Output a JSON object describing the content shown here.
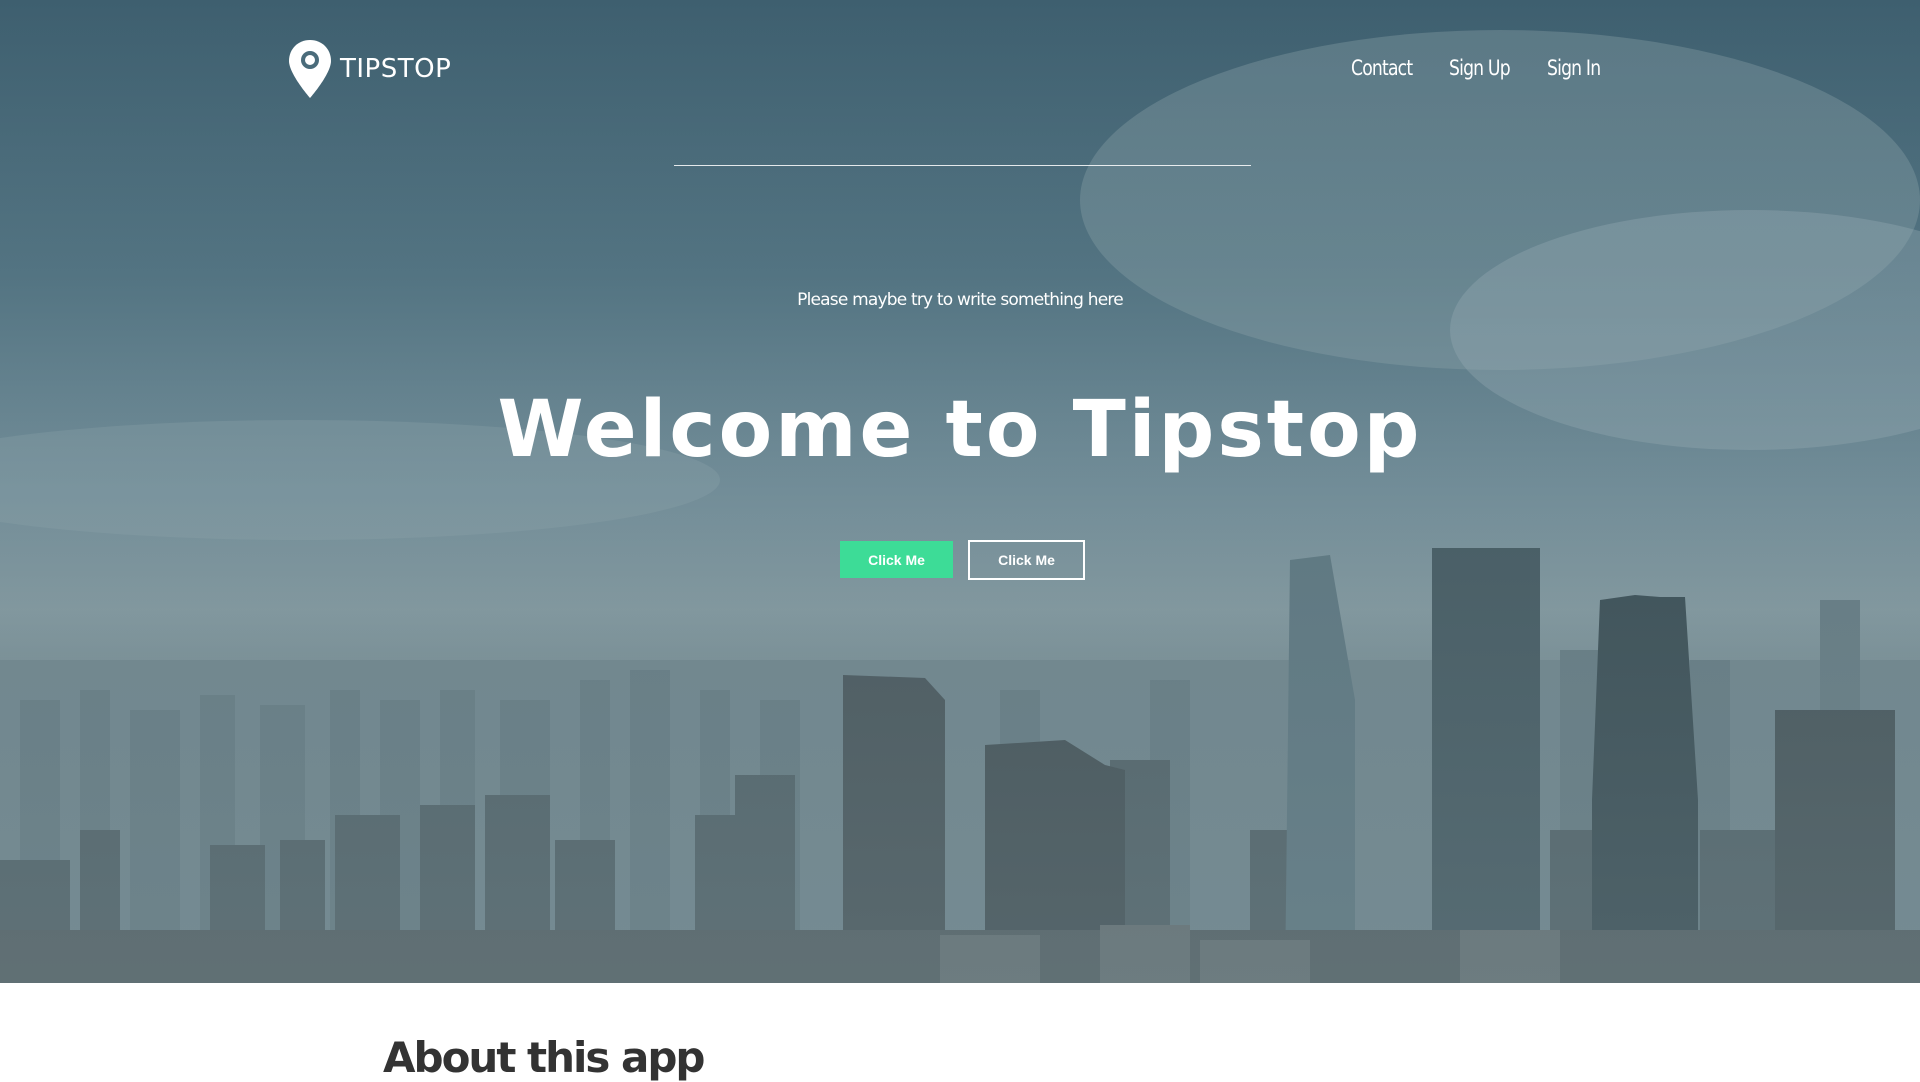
{
  "header": {
    "logo_text": "TIPSTOP",
    "nav": [
      {
        "label": "Contact"
      },
      {
        "label": "Sign Up"
      },
      {
        "label": "Sign In"
      }
    ]
  },
  "hero": {
    "tagline": "Please maybe try to write something here",
    "title": "Welcome to Tipstop",
    "primary_button": "Click Me",
    "secondary_button": "Click Me"
  },
  "about": {
    "heading": "About this app"
  },
  "colors": {
    "accent": "#3ddc97",
    "overlay": "#3e5f6f"
  }
}
